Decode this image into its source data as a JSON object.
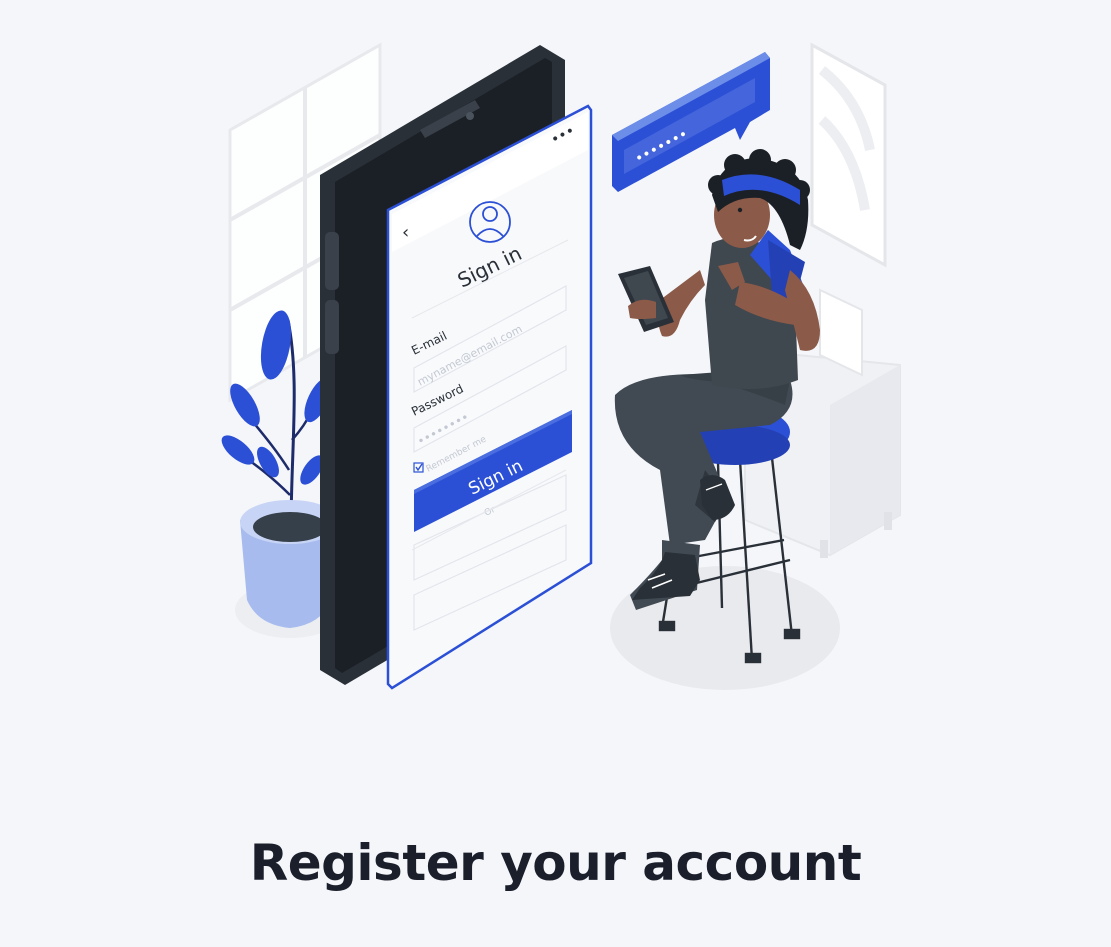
{
  "illustration": {
    "phone_screen": {
      "title": "Sign in",
      "email_label": "E-mail",
      "email_placeholder": "myname@email.com",
      "password_label": "Password",
      "password_mask": "••••••••",
      "remember_label": "Remember me",
      "submit_label": "Sign in",
      "or_label": "Or"
    },
    "speech_bubble": {
      "password_mask": "•••••••"
    }
  },
  "colors": {
    "background": "#f4f6fa",
    "accent": "#2b50d6",
    "accent_light": "#6d8ee8",
    "phone_body": "#2a3038",
    "title_text": "#1b1f2b"
  },
  "page_title": "Register your account"
}
